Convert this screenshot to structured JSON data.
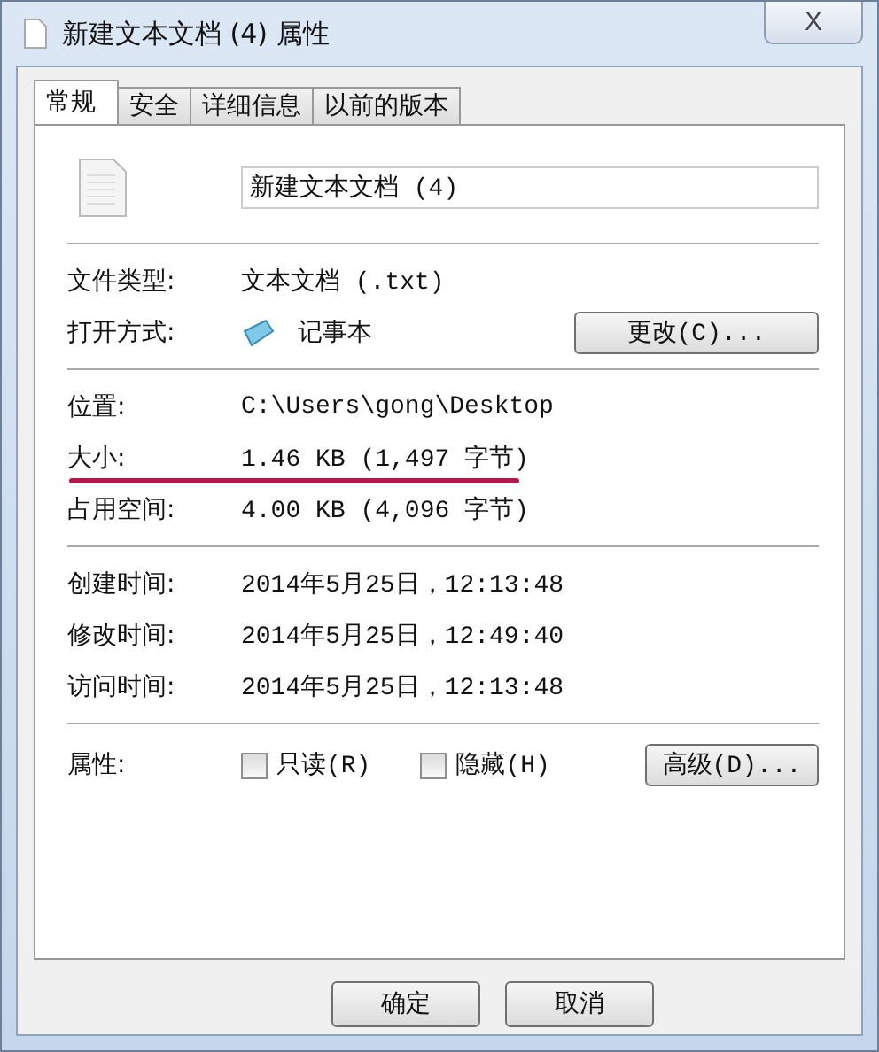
{
  "window": {
    "title": "新建文本文档 (4) 属性",
    "close": "X"
  },
  "tabs": [
    {
      "label": "常规",
      "selected": true
    },
    {
      "label": "安全",
      "selected": false
    },
    {
      "label": "详细信息",
      "selected": false
    },
    {
      "label": "以前的版本",
      "selected": false
    }
  ],
  "file_name": {
    "value": "新建文本文档 (4)"
  },
  "sections": [
    [
      {
        "kind": "text",
        "label": "文件类型:",
        "value": "文本文档 (.txt)",
        "highlighted": false
      },
      {
        "kind": "app",
        "label": "打开方式:",
        "value": "记事本",
        "button": "更改(C)...",
        "highlighted": false
      }
    ],
    [
      {
        "kind": "text",
        "label": "位置:",
        "value": "C:\\Users\\gong\\Desktop",
        "highlighted": false
      },
      {
        "kind": "text",
        "label": "大小:",
        "value": "1.46 KB (1,497 字节)",
        "highlighted": true
      },
      {
        "kind": "text",
        "label": "占用空间:",
        "value": "4.00 KB (4,096 字节)",
        "highlighted": false
      }
    ],
    [
      {
        "kind": "text",
        "label": "创建时间:",
        "value": "2014年5月25日，12:13:48",
        "highlighted": false
      },
      {
        "kind": "text",
        "label": "修改时间:",
        "value": "2014年5月25日，12:49:40",
        "highlighted": false
      },
      {
        "kind": "text",
        "label": "访问时间:",
        "value": "2014年5月25日，12:13:48",
        "highlighted": false
      }
    ]
  ],
  "attributes": {
    "label": "属性:",
    "checkboxes": [
      {
        "label": "只读(R)",
        "checked": false
      },
      {
        "label": "隐藏(H)",
        "checked": false
      }
    ],
    "button": "高级(D)..."
  },
  "buttons": [
    "确定",
    "取消"
  ]
}
